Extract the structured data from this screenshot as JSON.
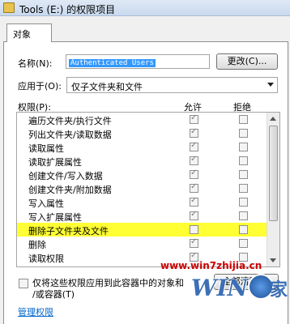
{
  "window": {
    "title": "Tools (E:) 的权限项目"
  },
  "tab": {
    "label": "对象"
  },
  "name_field": {
    "label": "名称(N):",
    "value": "Authenticated Users"
  },
  "change_button": {
    "label": "更改(C)..."
  },
  "apply_to": {
    "label": "应用于(O):",
    "selected": "仅子文件夹和文件"
  },
  "permissions": {
    "header": "权限(P):",
    "allow_header": "允许",
    "deny_header": "拒绝",
    "rows": [
      {
        "label": "遍历文件夹/执行文件",
        "allow": true,
        "deny": false
      },
      {
        "label": "列出文件夹/读取数据",
        "allow": true,
        "deny": false
      },
      {
        "label": "读取属性",
        "allow": true,
        "deny": false
      },
      {
        "label": "读取扩展属性",
        "allow": true,
        "deny": false
      },
      {
        "label": "创建文件/写入数据",
        "allow": true,
        "deny": false
      },
      {
        "label": "创建文件夹/附加数据",
        "allow": true,
        "deny": false
      },
      {
        "label": "写入属性",
        "allow": true,
        "deny": false
      },
      {
        "label": "写入扩展属性",
        "allow": true,
        "deny": false
      },
      {
        "label": "删除子文件夹及文件",
        "allow": false,
        "deny": false,
        "highlighted": true
      },
      {
        "label": "删除",
        "allow": true,
        "deny": false
      },
      {
        "label": "读取权限",
        "allow": true,
        "deny": false
      }
    ]
  },
  "apply_only_checkbox": {
    "label_line1": "仅将这些权限应用到此容器中的对象和",
    "label_line2": "/或容器(T)",
    "checked": false
  },
  "clear_all_button": {
    "label": "全部清除(L)"
  },
  "manage_link": {
    "label": "管理权限"
  },
  "watermark": {
    "url": "www.win7zhijia.cn",
    "logo_text": "WIN7",
    "logo_suffix": "家"
  },
  "colors": {
    "highlight": "#ffff33",
    "selection": "#3399ff",
    "link": "#0066cc",
    "watermark": "#cc0000"
  }
}
